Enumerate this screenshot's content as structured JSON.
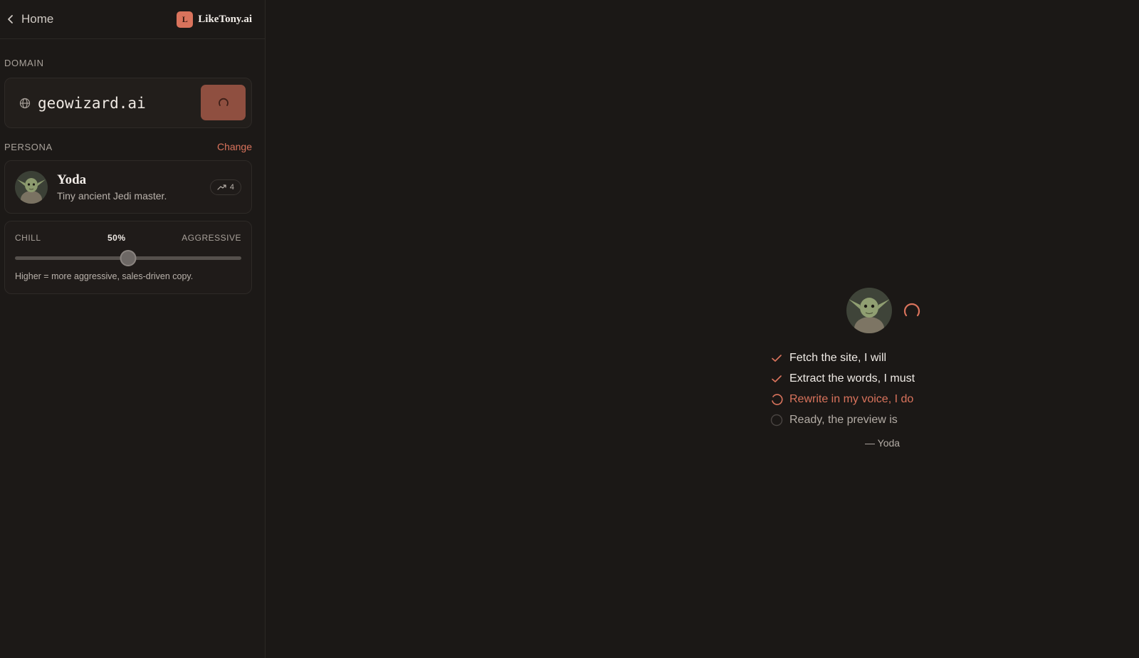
{
  "topbar": {
    "home_label": "Home",
    "brand_letter": "L",
    "brand_name": "LikeTony.ai"
  },
  "domain": {
    "label": "DOMAIN",
    "value": "geowizard.ai"
  },
  "persona": {
    "label": "PERSONA",
    "change_label": "Change",
    "name": "Yoda",
    "description": "Tiny ancient Jedi master.",
    "trend_count": "4"
  },
  "tone": {
    "left_label": "CHILL",
    "right_label": "AGGRESSIVE",
    "value_label": "50%",
    "value": 0.5,
    "hint": "Higher = more aggressive, sales-driven copy."
  },
  "progress": {
    "steps": [
      {
        "label": "Fetch the site, I will",
        "status": "done"
      },
      {
        "label": "Extract the words, I must",
        "status": "done"
      },
      {
        "label": "Rewrite in my voice, I do",
        "status": "active"
      },
      {
        "label": "Ready, the preview is",
        "status": "pending"
      }
    ],
    "signature": "— Yoda"
  },
  "colors": {
    "accent": "#d9735c",
    "background": "#1b1816",
    "button": "#8f4f40"
  },
  "icons": [
    "chevron-left-icon",
    "globe-icon",
    "spinner-icon",
    "trend-up-icon",
    "check-icon",
    "empty-circle-icon"
  ]
}
